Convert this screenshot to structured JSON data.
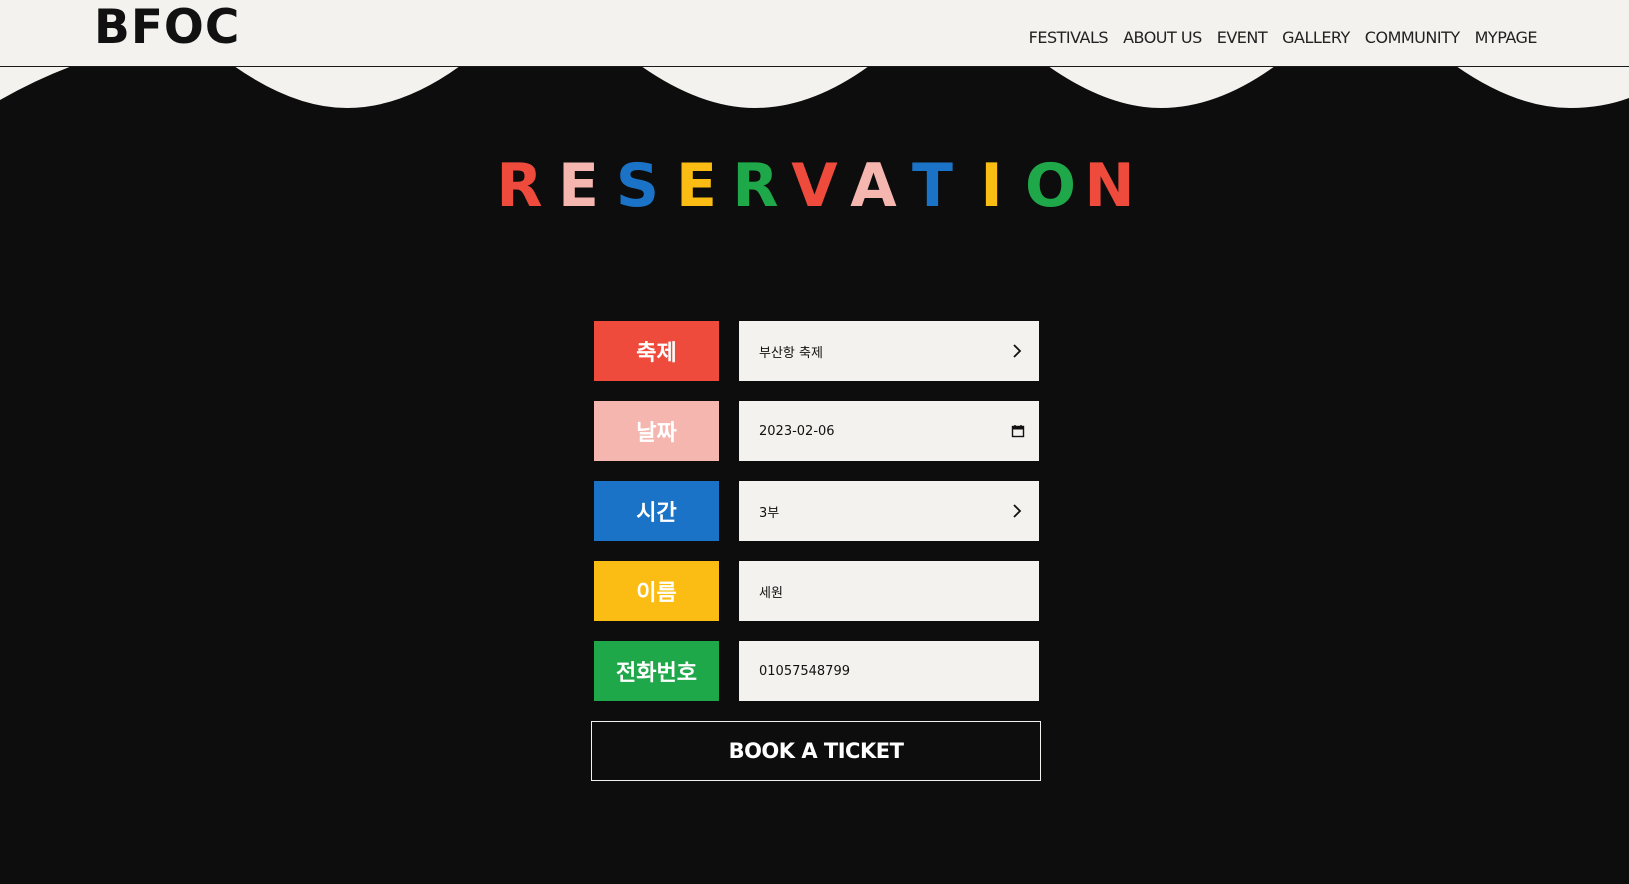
{
  "header": {
    "logo": "BFOC",
    "nav": [
      "FESTIVALS",
      "ABOUT US",
      "EVENT",
      "GALLERY",
      "COMMUNITY",
      "MYPAGE"
    ]
  },
  "title": {
    "letters": [
      "R",
      "E",
      "S",
      "E",
      "R",
      "V",
      "A",
      "T",
      "I",
      "O",
      "N"
    ],
    "colors": [
      "#ee4b3d",
      "#f5b6b0",
      "#1a73c6",
      "#fbbd14",
      "#1fa84a",
      "#ee4b3d",
      "#f5b6b0",
      "#1a73c6",
      "#fbbd14",
      "#1fa84a",
      "#ee4b3d"
    ]
  },
  "form": {
    "rows": [
      {
        "label": "축제",
        "value": "부산항 축제",
        "color": "#ee4b3d",
        "icon": "chevron-right-icon"
      },
      {
        "label": "날짜",
        "value": "2023-02-06",
        "color": "#f5b6b0",
        "icon": "calendar-icon"
      },
      {
        "label": "시간",
        "value": "3부",
        "color": "#1a73c6",
        "icon": "chevron-right-icon"
      },
      {
        "label": "이름",
        "value": "세원",
        "color": "#fbbd14",
        "icon": ""
      },
      {
        "label": "전화번호",
        "value": "01057548799",
        "color": "#1fa84a",
        "icon": ""
      }
    ],
    "submit_label": "BOOK A TICKET"
  },
  "colors": {
    "background": "#0d0d0d",
    "header_bg": "#f3f2ee",
    "field_bg": "#f3f2ee"
  }
}
